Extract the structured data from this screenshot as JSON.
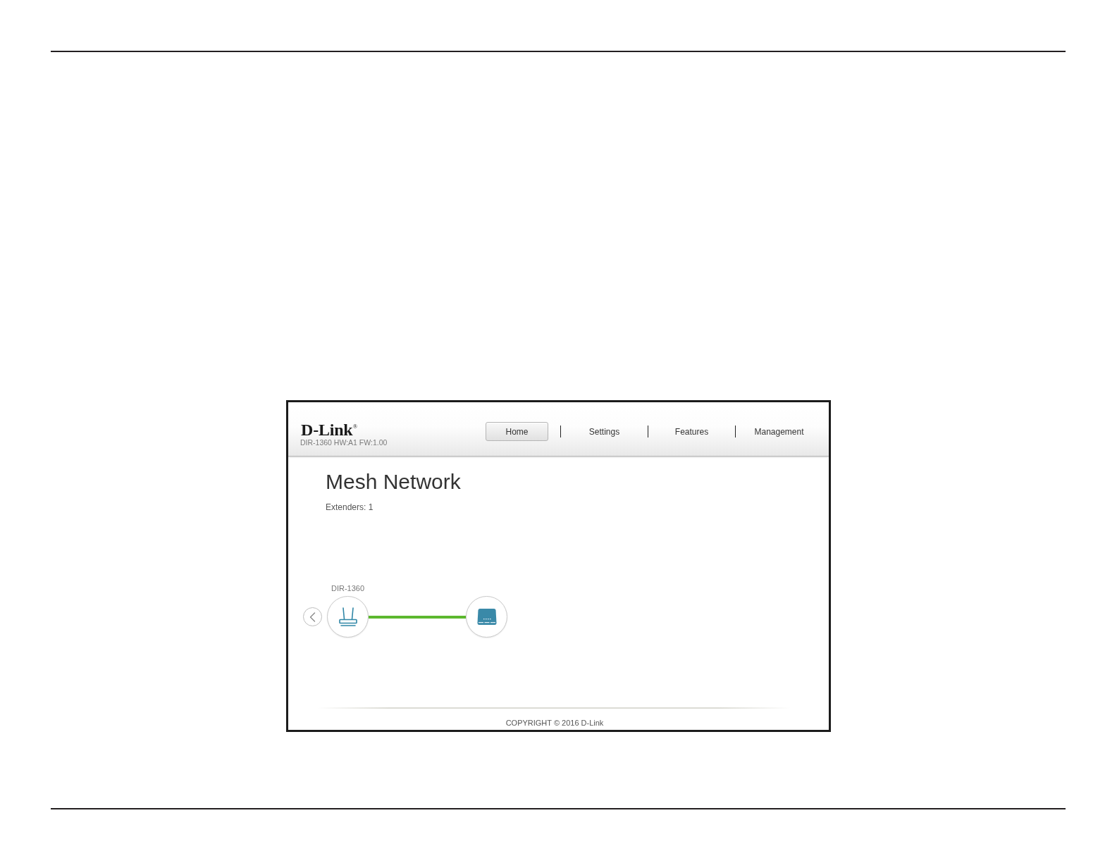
{
  "header": {
    "logo": "D-Link$^{®}$",
    "device_info": "DIR-1360 HW:A1 FW:1.00",
    "tabs": [
      {
        "label": "Home",
        "selected": true
      },
      {
        "label": "Settings",
        "selected": false
      },
      {
        "label": "Features",
        "selected": false
      },
      {
        "label": "Management",
        "selected": false
      }
    ]
  },
  "page": {
    "title": "Mesh Network",
    "extenders": "Extenders: 1"
  },
  "topology": {
    "nodes": [
      {
        "kind": "router",
        "label": "DIR-1360"
      },
      {
        "kind": "extender"
      }
    ]
  },
  "footer": {
    "copyright": "COPYRIGHT © 2016 D-Link"
  }
}
